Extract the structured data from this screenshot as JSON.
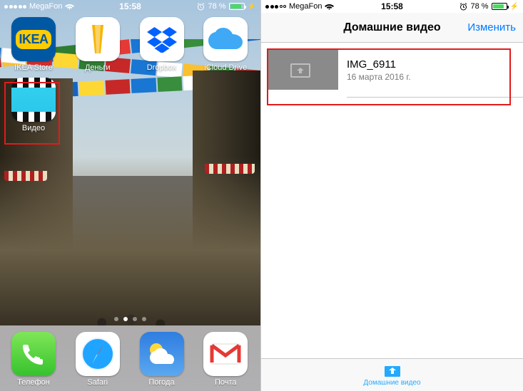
{
  "status": {
    "carrier": "MegaFon",
    "time": "15:58",
    "battery_pct": "78 %"
  },
  "left": {
    "apps": [
      {
        "id": "ikea",
        "label": "IKEA Store"
      },
      {
        "id": "money",
        "label": "Деньги"
      },
      {
        "id": "dropbox",
        "label": "Dropbox"
      },
      {
        "id": "icloud",
        "label": "iCloud Drive"
      },
      {
        "id": "videos",
        "label": "Видео"
      }
    ],
    "dock": [
      {
        "id": "phone",
        "label": "Телефон"
      },
      {
        "id": "safari",
        "label": "Safari"
      },
      {
        "id": "weather",
        "label": "Погода"
      },
      {
        "id": "mail",
        "label": "Почта"
      }
    ]
  },
  "right": {
    "nav_title": "Домашние видео",
    "nav_edit": "Изменить",
    "video": {
      "title": "IMG_6911",
      "date": "16 марта 2016 г."
    },
    "tab_label": "Домашние видео"
  }
}
